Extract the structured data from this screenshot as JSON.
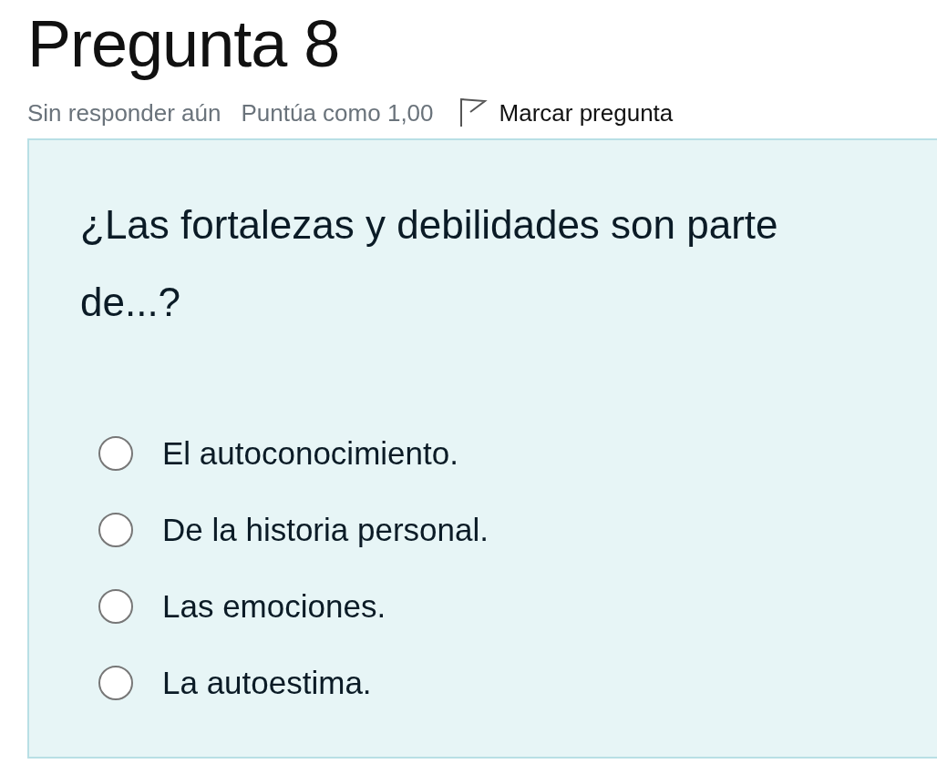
{
  "title": "Pregunta 8",
  "info": {
    "status": "Sin responder aún",
    "grade": "Puntúa como 1,00",
    "flag_label": "Marcar pregunta",
    "flagged": false
  },
  "question": "¿Las fortalezas y debilidades son parte de...?",
  "options": [
    {
      "label": "El autoconocimiento.",
      "selected": false
    },
    {
      "label": "De la historia personal.",
      "selected": false
    },
    {
      "label": "Las emociones.",
      "selected": false
    },
    {
      "label": "La autoestima.",
      "selected": false
    }
  ]
}
